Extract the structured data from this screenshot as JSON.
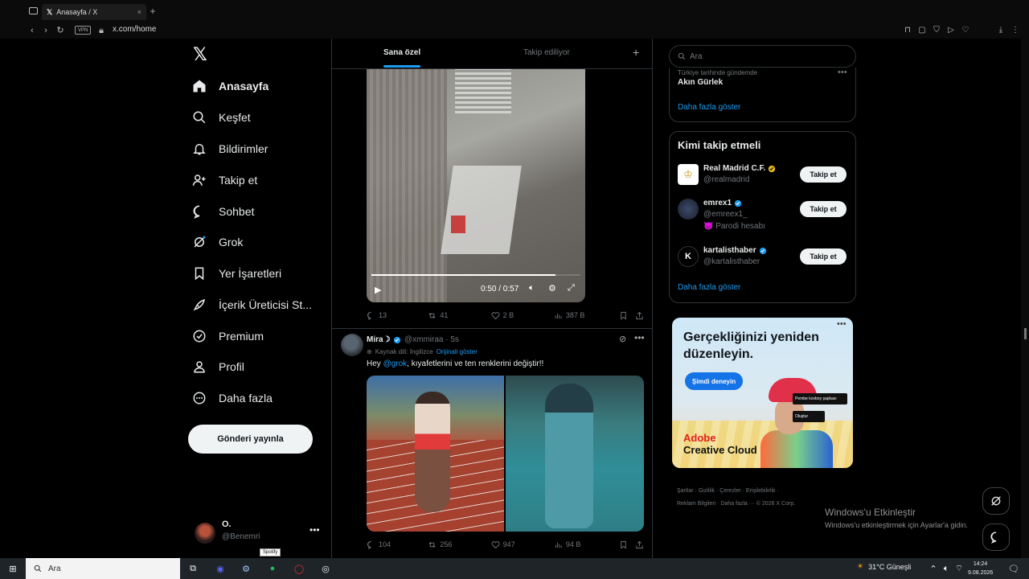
{
  "browser": {
    "tab_title": "Anasayfa / X",
    "url": "x.com/home",
    "vpn_label": "VPN",
    "new_tab": "+"
  },
  "nav": {
    "items": [
      {
        "label": "Anasayfa",
        "icon": "home-icon",
        "active": true
      },
      {
        "label": "Keşfet",
        "icon": "search-icon"
      },
      {
        "label": "Bildirimler",
        "icon": "bell-icon"
      },
      {
        "label": "Takip et",
        "icon": "follow-icon"
      },
      {
        "label": "Sohbet",
        "icon": "chat-icon"
      },
      {
        "label": "Grok",
        "icon": "grok-icon"
      },
      {
        "label": "Yer İşaretleri",
        "icon": "bookmark-icon"
      },
      {
        "label": "İçerik Üreticisi St...",
        "icon": "rocket-icon"
      },
      {
        "label": "Premium",
        "icon": "verified-icon"
      },
      {
        "label": "Profil",
        "icon": "person-icon"
      },
      {
        "label": "Daha fazla",
        "icon": "more-circle-icon"
      }
    ],
    "post_button": "Gönderi yayınla",
    "account": {
      "name": "O.",
      "handle": "@Benemri"
    }
  },
  "feed": {
    "tabs": [
      "Sana özel",
      "Takip ediliyor"
    ],
    "tweet1": {
      "video_time": "0:50 / 0:57",
      "video_progress": 0.88,
      "replies": "13",
      "retweets": "41",
      "likes": "2 B",
      "views": "387 B"
    },
    "tweet2": {
      "name": "Mira☽",
      "handle": "@xmmiraa · 5s",
      "source_label": "Kaynak dili: İngilizce",
      "source_link": "Orijinali göster",
      "text_prefix": "Hey ",
      "mention": "@grok",
      "text_suffix": ", kıyafetlerini ve ten renklerini değiştir!!",
      "replies": "104",
      "retweets": "256",
      "likes": "947",
      "views": "94 B"
    }
  },
  "right": {
    "search_placeholder": "Ara",
    "trend": {
      "context": "Türkiye tarihinde gündemde",
      "name": "Akın Gürlek",
      "show_more": "Daha fazla göster"
    },
    "who_to_follow": {
      "title": "Kimi takip etmeli",
      "accounts": [
        {
          "name": "Real Madrid C.F.",
          "handle": "@realmadrid",
          "bio": "",
          "badge": "gold",
          "follow": "Takip et"
        },
        {
          "name": "emrex1",
          "handle": "@emreex1_",
          "bio": "😈 Parodi hesabı",
          "badge": "blue",
          "follow": "Takip et"
        },
        {
          "name": "kartalisthaber",
          "handle": "@kartalisthaber",
          "bio": "",
          "badge": "blue",
          "follow": "Takip et"
        }
      ],
      "show_more": "Daha fazla göster"
    },
    "ad": {
      "headline": "Gerçekliğinizi yeniden düzenleyin.",
      "cta": "Şimdi deneyin",
      "box1": "Pembe kovboy şapkası",
      "box2": "Oluştur",
      "brand1": "Adobe",
      "brand2": "Creative Cloud"
    },
    "footer": {
      "line1": "Şartlar · Gizlilik · Çerezler · Erişilebilirlik ·",
      "line2": "Reklam Bilgileri · Daha fazla ··· © 2026 X Corp."
    }
  },
  "windows": {
    "activation_title": "Windows'u Etkinleştir",
    "activation_sub": "Windows'u etkinleştirmek için Ayarlar'a gidin.",
    "taskbar_search": "Ara",
    "tooltip": "Spotify",
    "weather": "31°C  Güneşli",
    "time": "14:24",
    "date": "9.08.2026"
  }
}
